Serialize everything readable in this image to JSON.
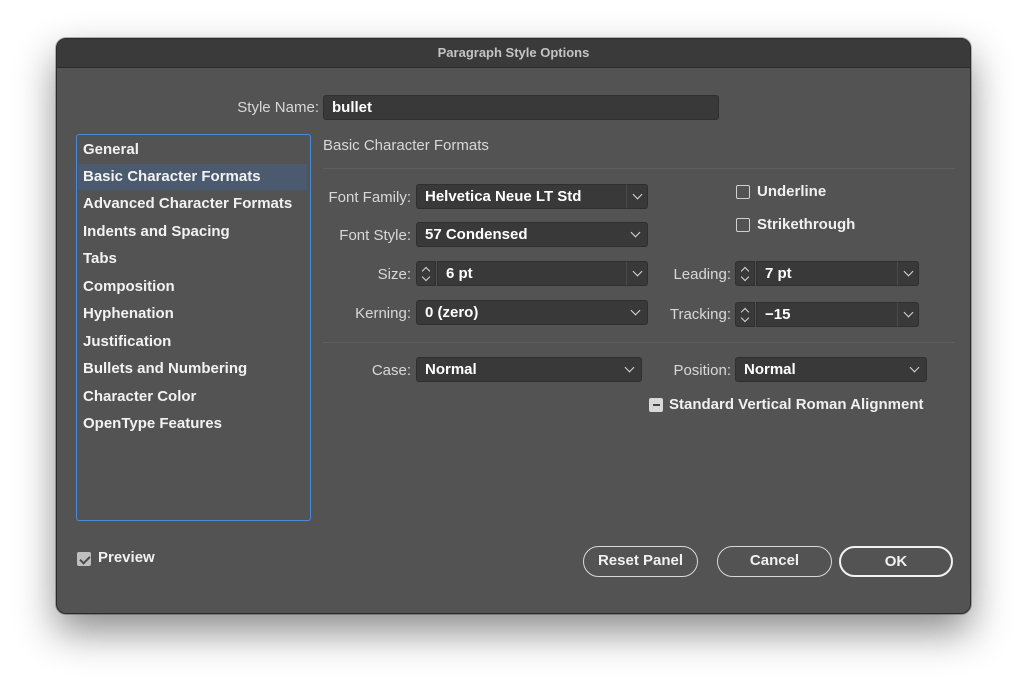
{
  "window": {
    "title": "Paragraph Style Options"
  },
  "style_name": {
    "label": "Style Name:",
    "value": "bullet"
  },
  "sidebar": {
    "items": [
      {
        "label": "General",
        "selected": false
      },
      {
        "label": "Basic Character Formats",
        "selected": true
      },
      {
        "label": "Advanced Character Formats",
        "selected": false
      },
      {
        "label": "Indents and Spacing",
        "selected": false
      },
      {
        "label": "Tabs",
        "selected": false
      },
      {
        "label": "Composition",
        "selected": false
      },
      {
        "label": "Hyphenation",
        "selected": false
      },
      {
        "label": "Justification",
        "selected": false
      },
      {
        "label": "Bullets and Numbering",
        "selected": false
      },
      {
        "label": "Character Color",
        "selected": false
      },
      {
        "label": "OpenType Features",
        "selected": false
      }
    ]
  },
  "panel": {
    "title": "Basic Character Formats",
    "font_family": {
      "label": "Font Family:",
      "value": "Helvetica Neue LT Std"
    },
    "font_style": {
      "label": "Font Style:",
      "value": "57 Condensed"
    },
    "size": {
      "label": "Size:",
      "value": "6 pt"
    },
    "leading": {
      "label": "Leading:",
      "value": "7 pt"
    },
    "kerning": {
      "label": "Kerning:",
      "value": "0 (zero)"
    },
    "tracking": {
      "label": "Tracking:",
      "value": "−15"
    },
    "case": {
      "label": "Case:",
      "value": "Normal"
    },
    "position": {
      "label": "Position:",
      "value": "Normal"
    },
    "underline": {
      "label": "Underline",
      "checked": false
    },
    "strikethrough": {
      "label": "Strikethrough",
      "checked": false
    },
    "vertical_roman": {
      "label": "Standard Vertical Roman Alignment",
      "state": "mixed"
    }
  },
  "preview": {
    "label": "Preview",
    "checked": true
  },
  "buttons": {
    "reset": "Reset Panel",
    "cancel": "Cancel",
    "ok": "OK"
  }
}
